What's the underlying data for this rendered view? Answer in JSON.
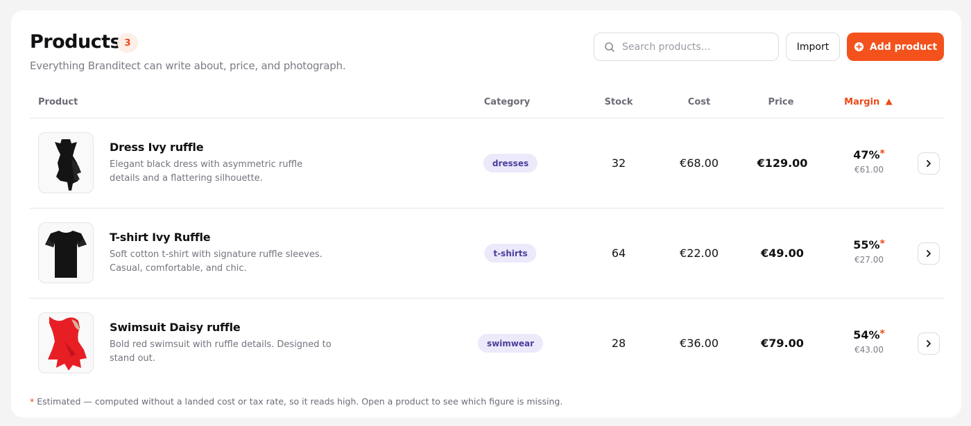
{
  "header": {
    "title": "Products",
    "count": "3",
    "subtitle": "Everything Branditect can write about, price, and photograph."
  },
  "toolbar": {
    "search_placeholder": "Search products...",
    "search_value": "",
    "import_label": "Import",
    "add_label": "Add product"
  },
  "table": {
    "columns": {
      "product": "Product",
      "category": "Category",
      "stock": "Stock",
      "cost": "Cost",
      "price": "Price",
      "margin": "Margin",
      "margin_sort_icon": "triangle-up-icon"
    },
    "rows": [
      {
        "name": "Dress Ivy ruffle",
        "description": "Elegant black dress with asymmetric ruffle details and a flattering silhouette.",
        "category": "dresses",
        "stock": "32",
        "cost": "€68.00",
        "price": "€129.00",
        "margin_pct": "47%",
        "margin_amount": "€61.00",
        "thumbnail_icon": "black-dress-icon"
      },
      {
        "name": "T-shirt Ivy Ruffle",
        "description": "Soft cotton t-shirt with signature ruffle sleeves. Casual, comfortable, and chic.",
        "category": "t-shirts",
        "stock": "64",
        "cost": "€22.00",
        "price": "€49.00",
        "margin_pct": "55%",
        "margin_amount": "€27.00",
        "thumbnail_icon": "black-tshirt-icon"
      },
      {
        "name": "Swimsuit Daisy ruffle",
        "description": "Bold red swimsuit with ruffle details. Designed to stand out.",
        "category": "swimwear",
        "stock": "28",
        "cost": "€36.00",
        "price": "€79.00",
        "margin_pct": "54%",
        "margin_amount": "€43.00",
        "thumbnail_icon": "red-swimsuit-icon"
      }
    ]
  },
  "footnote": {
    "marker": "*",
    "text": "Estimated — computed without a landed cost or tax rate, so it reads high. Open a product to see which figure is missing."
  },
  "colors": {
    "accent": "#f3521d",
    "badge_bg": "#fdeee6",
    "category_bg": "#ece9fb",
    "category_text": "#4a3f9a"
  }
}
